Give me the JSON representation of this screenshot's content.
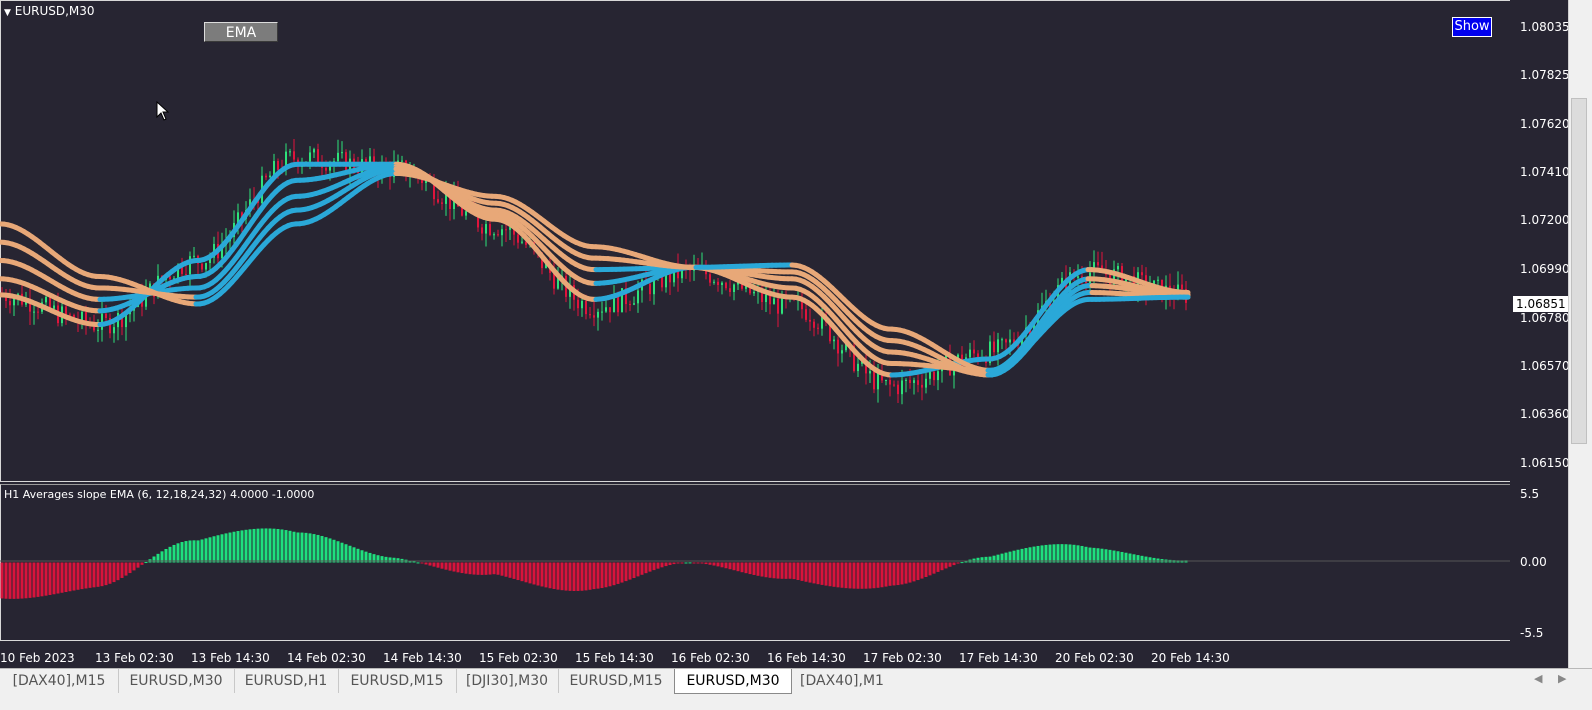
{
  "window": {
    "symbol_title": "EURUSD,M30",
    "ema_button": "EMA",
    "show_button": "Show",
    "current_price": "1.06851"
  },
  "price_axis": [
    "1.08035",
    "1.07825",
    "1.07620",
    "1.07410",
    "1.07200",
    "1.06990",
    "1.06780",
    "1.06570",
    "1.06360",
    "1.06150"
  ],
  "time_axis": [
    "10 Feb 2023",
    "13 Feb 02:30",
    "13 Feb 14:30",
    "14 Feb 02:30",
    "14 Feb 14:30",
    "15 Feb 02:30",
    "15 Feb 14:30",
    "16 Feb 02:30",
    "16 Feb 14:30",
    "17 Feb 02:30",
    "17 Feb 14:30",
    "20 Feb 02:30",
    "20 Feb 14:30"
  ],
  "indicator": {
    "title": "H1 Averages slope EMA (6, 12,18,24,32) 4.0000 -1.0000",
    "scale": [
      "5.5",
      "0.00",
      "-5.5"
    ]
  },
  "tabs": [
    {
      "label": "[DAX40],M15",
      "active": false
    },
    {
      "label": "EURUSD,M30",
      "active": false
    },
    {
      "label": "EURUSD,H1",
      "active": false
    },
    {
      "label": "EURUSD,M15",
      "active": false
    },
    {
      "label": "[DJI30],M30",
      "active": false
    },
    {
      "label": "EURUSD,M15",
      "active": false
    },
    {
      "label": "EURUSD,M30",
      "active": true
    },
    {
      "label": "[DAX40],M1",
      "active": false
    }
  ],
  "colors": {
    "background": "#272532",
    "bull_candle": "#2ee27a",
    "bear_candle": "#e0143c",
    "ema_up": "#2aa8d8",
    "ema_down": "#e8a878",
    "hist_pos": "#1fe07e",
    "hist_neg": "#d8143c"
  },
  "chart_data": {
    "type": "line",
    "symbol": "EURUSD",
    "timeframe": "M30",
    "ylim": [
      1.0605,
      1.0812
    ],
    "x": [
      "10 Feb 2023",
      "13 Feb 02:30",
      "13 Feb 14:30",
      "14 Feb 02:30",
      "14 Feb 14:30",
      "15 Feb 02:30",
      "15 Feb 14:30",
      "16 Feb 02:30",
      "16 Feb 14:30",
      "17 Feb 02:30",
      "17 Feb 14:30",
      "20 Feb 02:30",
      "20 Feb 14:30"
    ],
    "close": [
      1.0685,
      1.0672,
      1.07,
      1.0745,
      1.074,
      1.0715,
      1.068,
      1.0695,
      1.068,
      1.0645,
      1.066,
      1.0695,
      1.0685
    ],
    "series": [
      {
        "name": "EMA 6",
        "values": [
          1.0685,
          1.0672,
          1.07,
          1.0742,
          1.0742,
          1.0718,
          1.0683,
          1.0697,
          1.0684,
          1.065,
          1.0657,
          1.0696,
          1.0686
        ]
      },
      {
        "name": "EMA 12",
        "values": [
          1.0692,
          1.0678,
          1.0693,
          1.0735,
          1.0742,
          1.072,
          1.069,
          1.0697,
          1.0688,
          1.0655,
          1.0652,
          1.0692,
          1.0685
        ]
      },
      {
        "name": "EMA 18",
        "values": [
          1.07,
          1.0683,
          1.0688,
          1.0728,
          1.0741,
          1.0722,
          1.0696,
          1.0697,
          1.0692,
          1.066,
          1.065,
          1.0689,
          1.0685
        ]
      },
      {
        "name": "EMA 24",
        "values": [
          1.0708,
          1.0688,
          1.0684,
          1.0722,
          1.074,
          1.0725,
          1.0701,
          1.0697,
          1.0695,
          1.0665,
          1.065,
          1.0686,
          1.0684
        ]
      },
      {
        "name": "EMA 32",
        "values": [
          1.0716,
          1.0693,
          1.0681,
          1.0716,
          1.0738,
          1.0728,
          1.0706,
          1.0697,
          1.0698,
          1.067,
          1.0652,
          1.0683,
          1.0684
        ]
      }
    ],
    "histogram_ylim": [
      -5.5,
      5.5
    ]
  }
}
